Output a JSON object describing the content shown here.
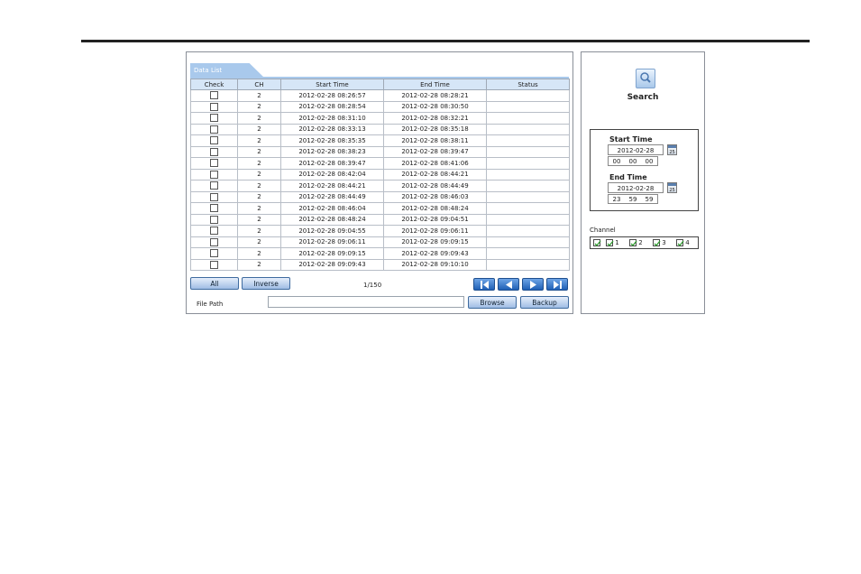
{
  "data_list": {
    "tab_label": "Data List",
    "columns": [
      "Check",
      "CH",
      "Start Time",
      "End Time",
      "Status"
    ],
    "rows": [
      {
        "ch": "2",
        "start": "2012-02-28 08:26:57",
        "end": "2012-02-28 08:28:21",
        "status": ""
      },
      {
        "ch": "2",
        "start": "2012-02-28 08:28:54",
        "end": "2012-02-28 08:30:50",
        "status": ""
      },
      {
        "ch": "2",
        "start": "2012-02-28 08:31:10",
        "end": "2012-02-28 08:32:21",
        "status": ""
      },
      {
        "ch": "2",
        "start": "2012-02-28 08:33:13",
        "end": "2012-02-28 08:35:18",
        "status": ""
      },
      {
        "ch": "2",
        "start": "2012-02-28 08:35:35",
        "end": "2012-02-28 08:38:11",
        "status": ""
      },
      {
        "ch": "2",
        "start": "2012-02-28 08:38:23",
        "end": "2012-02-28 08:39:47",
        "status": ""
      },
      {
        "ch": "2",
        "start": "2012-02-28 08:39:47",
        "end": "2012-02-28 08:41:06",
        "status": ""
      },
      {
        "ch": "2",
        "start": "2012-02-28 08:42:04",
        "end": "2012-02-28 08:44:21",
        "status": ""
      },
      {
        "ch": "2",
        "start": "2012-02-28 08:44:21",
        "end": "2012-02-28 08:44:49",
        "status": ""
      },
      {
        "ch": "2",
        "start": "2012-02-28 08:44:49",
        "end": "2012-02-28 08:46:03",
        "status": ""
      },
      {
        "ch": "2",
        "start": "2012-02-28 08:46:04",
        "end": "2012-02-28 08:48:24",
        "status": ""
      },
      {
        "ch": "2",
        "start": "2012-02-28 08:48:24",
        "end": "2012-02-28 09:04:51",
        "status": ""
      },
      {
        "ch": "2",
        "start": "2012-02-28 09:04:55",
        "end": "2012-02-28 09:06:11",
        "status": ""
      },
      {
        "ch": "2",
        "start": "2012-02-28 09:06:11",
        "end": "2012-02-28 09:09:15",
        "status": ""
      },
      {
        "ch": "2",
        "start": "2012-02-28 09:09:15",
        "end": "2012-02-28 09:09:43",
        "status": ""
      },
      {
        "ch": "2",
        "start": "2012-02-28 09:09:43",
        "end": "2012-02-28 09:10:10",
        "status": ""
      }
    ]
  },
  "controls": {
    "all_label": "All",
    "inverse_label": "Inverse",
    "page_info": "1/150",
    "file_path_label": "File Path",
    "file_path_value": "",
    "browse_label": "Browse",
    "backup_label": "Backup"
  },
  "search": {
    "label": "Search",
    "start_time_label": "Start Time",
    "start_date": "2012-02-28",
    "start_hh": "00",
    "start_mm": "00",
    "start_ss": "00",
    "end_time_label": "End Time",
    "end_date": "2012-02-28",
    "end_hh": "23",
    "end_mm": "59",
    "end_ss": "59",
    "calendar_day": "25"
  },
  "channel": {
    "title": "Channel",
    "items": [
      "1",
      "2",
      "3",
      "4"
    ]
  },
  "colors": {
    "tab": "#a9c9ec",
    "header": "#d6e6f7",
    "nav_button": "#2f6fc4",
    "checkmark": "#2f9a2f"
  },
  "icons": [
    "search-icon",
    "calendar-icon",
    "first-page-icon",
    "prev-page-icon",
    "next-page-icon",
    "last-page-icon",
    "checkmark-icon"
  ]
}
